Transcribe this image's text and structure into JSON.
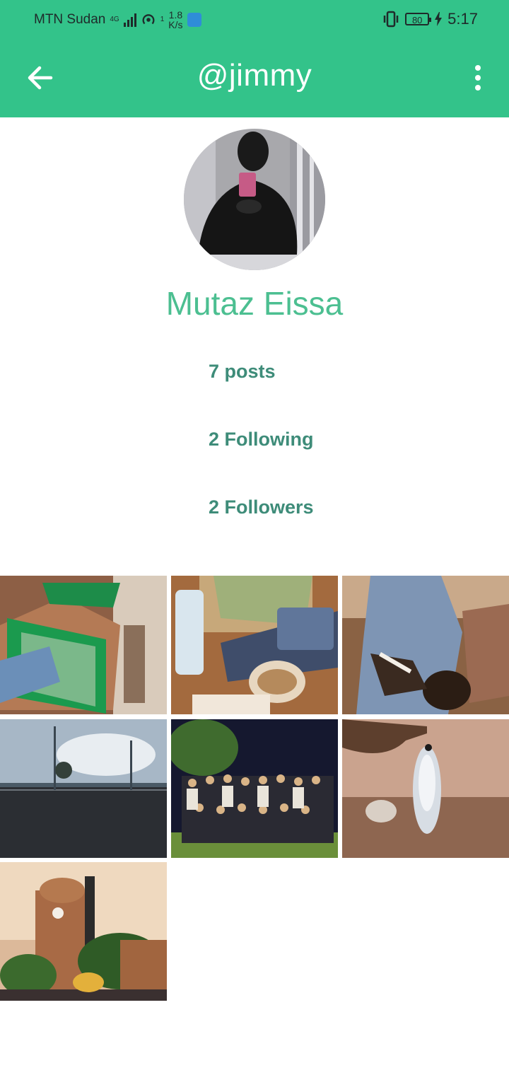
{
  "status_bar": {
    "carrier": "MTN Sudan",
    "network_badge": "4G",
    "sim_label": "1",
    "speed_value": "1.8",
    "speed_unit": "K/s",
    "battery": "80",
    "time": "5:17"
  },
  "app_bar": {
    "title": "@jimmy",
    "back_icon": "arrow-back-icon",
    "menu_icon": "more-vert-icon"
  },
  "profile": {
    "name": "Mutaz Eissa",
    "posts": "7 posts",
    "following": "2 Following",
    "followers": "2 Followers"
  },
  "posts_grid": {
    "count": 7,
    "items": [
      {
        "subject": "green plastic chairs and shadow"
      },
      {
        "subject": "water bottle, notebook and food container on table"
      },
      {
        "subject": "hand holding cigarette and coffee"
      },
      {
        "subject": "road at sunset with palm trees"
      },
      {
        "subject": "group photo at night"
      },
      {
        "subject": "hand holding small fish"
      },
      {
        "subject": "clock tower with crowd"
      }
    ]
  },
  "colors": {
    "primary": "#33c38a",
    "name_text": "#4cbf91",
    "stat_text": "#3e8c79",
    "background": "#ffffff"
  }
}
